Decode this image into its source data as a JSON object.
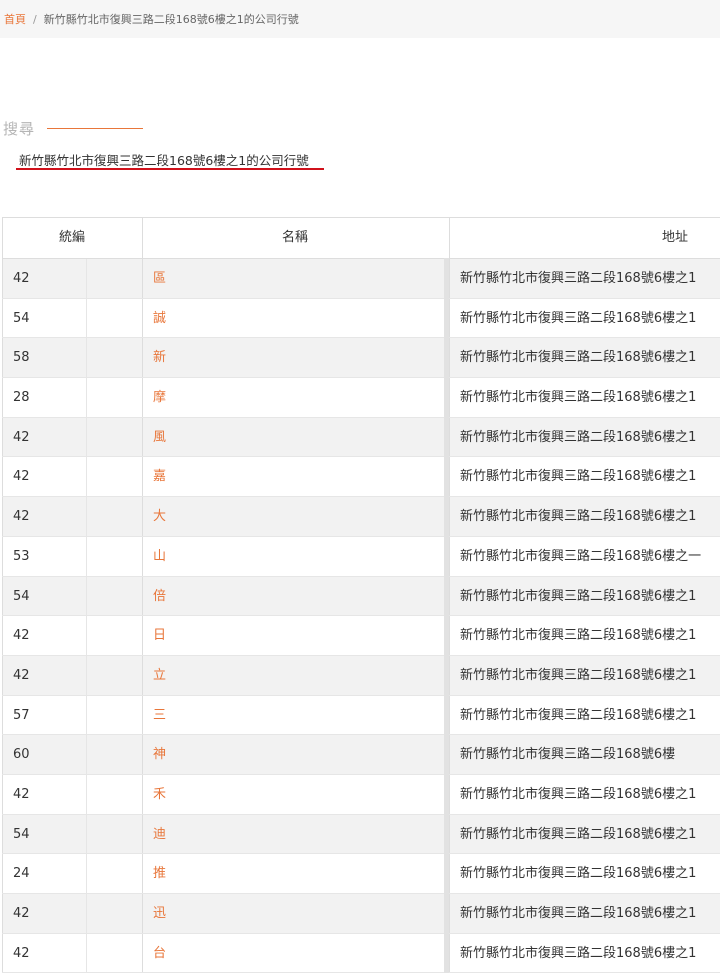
{
  "breadcrumb": {
    "home": "首頁",
    "separator": "/",
    "current": "新竹縣竹北市復興三路二段168號6樓之1的公司行號"
  },
  "search": {
    "label": "搜尋",
    "query": "新竹縣竹北市復興三路二段168號6樓之1的公司行號"
  },
  "table": {
    "headers": [
      "統編",
      "名稱",
      "地址"
    ],
    "rows": [
      {
        "id": "42",
        "name": "區",
        "address": "新竹縣竹北市復興三路二段168號6樓之1"
      },
      {
        "id": "54",
        "name": "誠",
        "address": "新竹縣竹北市復興三路二段168號6樓之1"
      },
      {
        "id": "58",
        "name": "新",
        "address": "新竹縣竹北市復興三路二段168號6樓之1"
      },
      {
        "id": "28",
        "name": "摩",
        "address": "新竹縣竹北市復興三路二段168號6樓之1"
      },
      {
        "id": "42",
        "name": "風",
        "address": "新竹縣竹北市復興三路二段168號6樓之1"
      },
      {
        "id": "42",
        "name": "嘉",
        "address": "新竹縣竹北市復興三路二段168號6樓之1"
      },
      {
        "id": "42",
        "name": "大",
        "address": "新竹縣竹北市復興三路二段168號6樓之1"
      },
      {
        "id": "53",
        "name": "山",
        "address": "新竹縣竹北市復興三路二段168號6樓之一"
      },
      {
        "id": "54",
        "name": "倍",
        "address": "新竹縣竹北市復興三路二段168號6樓之1"
      },
      {
        "id": "42",
        "name": "日",
        "address": "新竹縣竹北市復興三路二段168號6樓之1"
      },
      {
        "id": "42",
        "name": "立",
        "address": "新竹縣竹北市復興三路二段168號6樓之1"
      },
      {
        "id": "57",
        "name": "三",
        "address": "新竹縣竹北市復興三路二段168號6樓之1"
      },
      {
        "id": "60",
        "name": "神",
        "address": "新竹縣竹北市復興三路二段168號6樓"
      },
      {
        "id": "42",
        "name": "禾",
        "address": "新竹縣竹北市復興三路二段168號6樓之1"
      },
      {
        "id": "54",
        "name": "迪",
        "address": "新竹縣竹北市復興三路二段168號6樓之1"
      },
      {
        "id": "24",
        "name": "推",
        "address": "新竹縣竹北市復興三路二段168號6樓之1"
      },
      {
        "id": "42",
        "name": "迅",
        "address": "新竹縣竹北市復興三路二段168號6樓之1"
      },
      {
        "id": "42",
        "name": "台",
        "address": "新竹縣竹北市復興三路二段168號6樓之1"
      }
    ]
  },
  "colors": {
    "accent": "#e8763a",
    "underline": "#d0111b"
  }
}
